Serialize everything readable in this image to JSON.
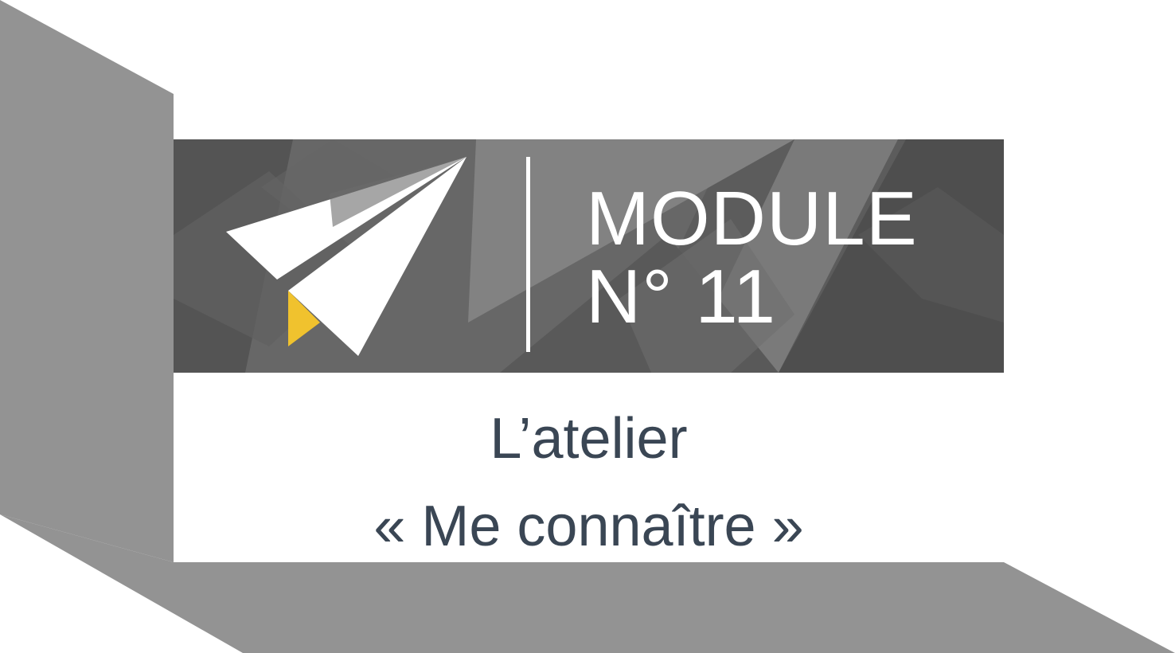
{
  "banner": {
    "line1": "MODULE",
    "line2": "N° 11",
    "icon": "paper-plane-icon"
  },
  "subtitle": {
    "line1": "L’atelier",
    "line2": "« Me connaître »"
  },
  "colors": {
    "frame_gray": "#939393",
    "banner_dark": "#5a5a5a",
    "accent_yellow": "#f0c22e",
    "text_dark": "#3a4654",
    "white": "#ffffff"
  }
}
